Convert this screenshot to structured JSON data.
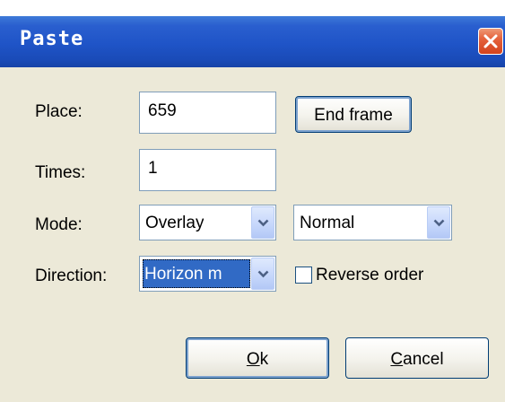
{
  "window": {
    "title": "Paste"
  },
  "fields": {
    "place_label": "Place:",
    "place_value": "659",
    "end_frame_label": "End frame",
    "times_label": "Times:",
    "times_value": "1",
    "mode_label": "Mode:",
    "mode_value": "Overlay",
    "blend_value": "Normal",
    "direction_label": "Direction:",
    "direction_value": "Horizon m",
    "reverse_label": "Reverse order",
    "reverse_checked": false
  },
  "buttons": {
    "ok_mnemonic": "O",
    "ok_rest": "k",
    "cancel_mnemonic": "C",
    "cancel_rest": "ancel"
  },
  "colors": {
    "titlebar": "#1f54c7",
    "dialog_bg": "#ece9d8",
    "selection": "#316ac5",
    "close_button": "#e5623c"
  },
  "icons": {
    "close": "close-icon",
    "dropdown": "chevron-down-icon"
  }
}
